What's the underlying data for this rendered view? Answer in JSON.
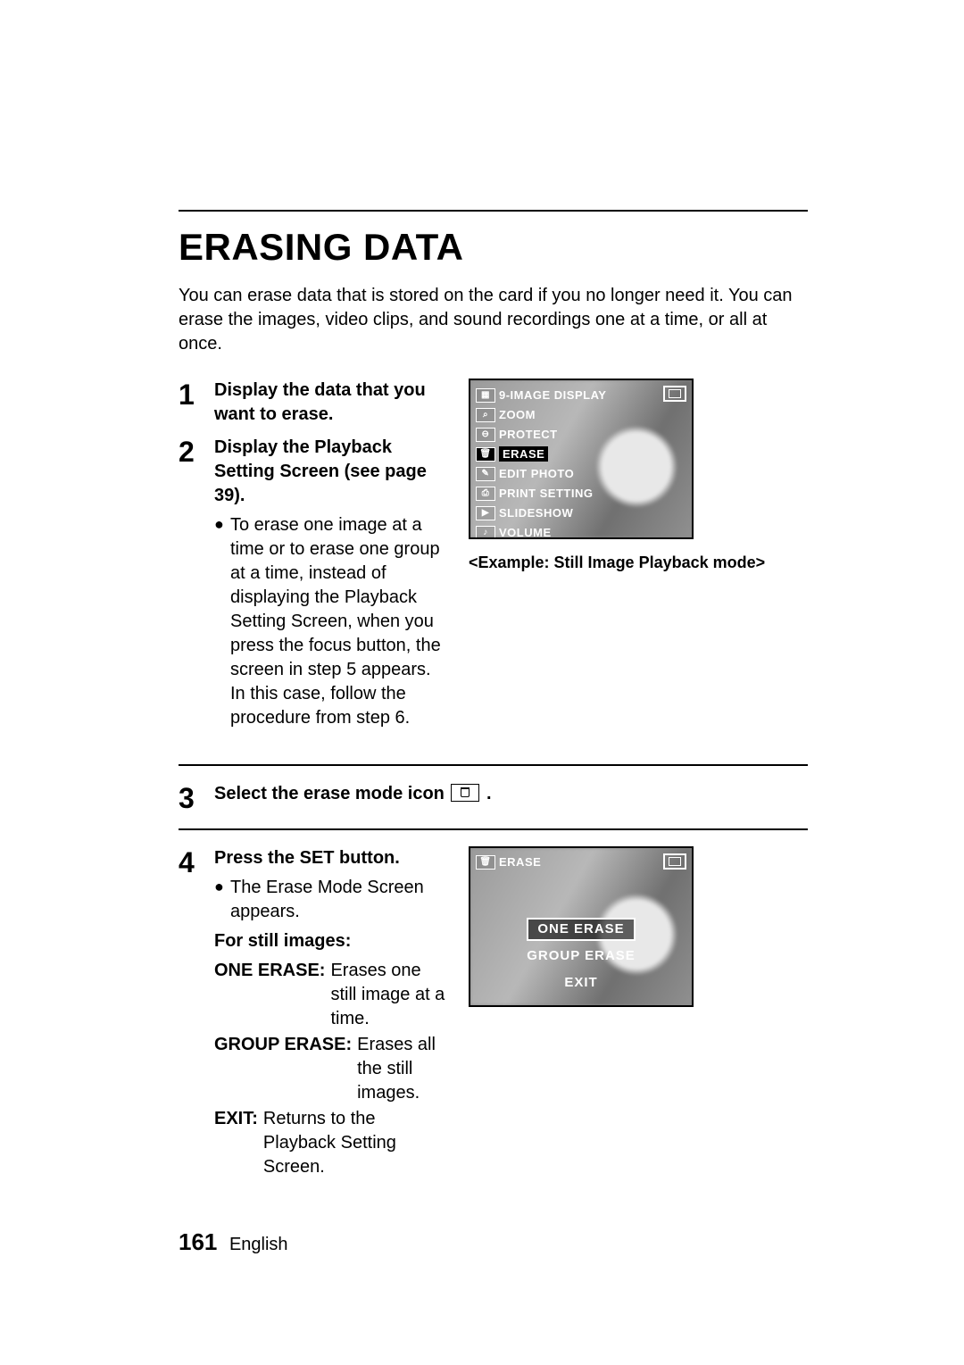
{
  "title": "ERASING DATA",
  "intro": "You can erase data that is stored on the card if you no longer need it. You can erase the images, video clips, and sound recordings one at a time, or all at once.",
  "steps": {
    "s1": {
      "num": "1",
      "text": "Display the data that you want to erase."
    },
    "s2": {
      "num": "2",
      "text": "Display the Playback Setting Screen (see page 39).",
      "bullet": "To erase one image at a time or to erase one group at a time, instead of displaying the Playback Setting Screen, when you press the focus button, the screen in step 5 appears. In this case, follow the procedure from step 6."
    },
    "s3": {
      "num": "3",
      "text_before": "Select the erase mode icon ",
      "text_after": "."
    },
    "s4": {
      "num": "4",
      "text": "Press the SET button.",
      "bullet": "The Erase Mode Screen appears.",
      "sub_heading": "For still images:",
      "defs": {
        "one": {
          "term": "ONE ERASE:",
          "def": "Erases one still image at a time."
        },
        "group": {
          "term": "GROUP ERASE:",
          "def": "Erases all the still images."
        },
        "exit": {
          "term": "EXIT:",
          "def": "Returns to the Playback Setting Screen."
        }
      }
    }
  },
  "lcd1": {
    "items": {
      "i0": "9-IMAGE DISPLAY",
      "i1": "ZOOM",
      "i2": "PROTECT",
      "i3": "ERASE",
      "i4": "EDIT PHOTO",
      "i5": "PRINT SETTING",
      "i6": "SLIDESHOW",
      "i7": "VOLUME"
    },
    "caption": "<Example: Still Image Playback mode>"
  },
  "lcd2": {
    "header": "ERASE",
    "opts": {
      "o0": "ONE ERASE",
      "o1": "GROUP ERASE",
      "o2": "EXIT"
    }
  },
  "footer": {
    "page": "161",
    "lang": "English"
  }
}
